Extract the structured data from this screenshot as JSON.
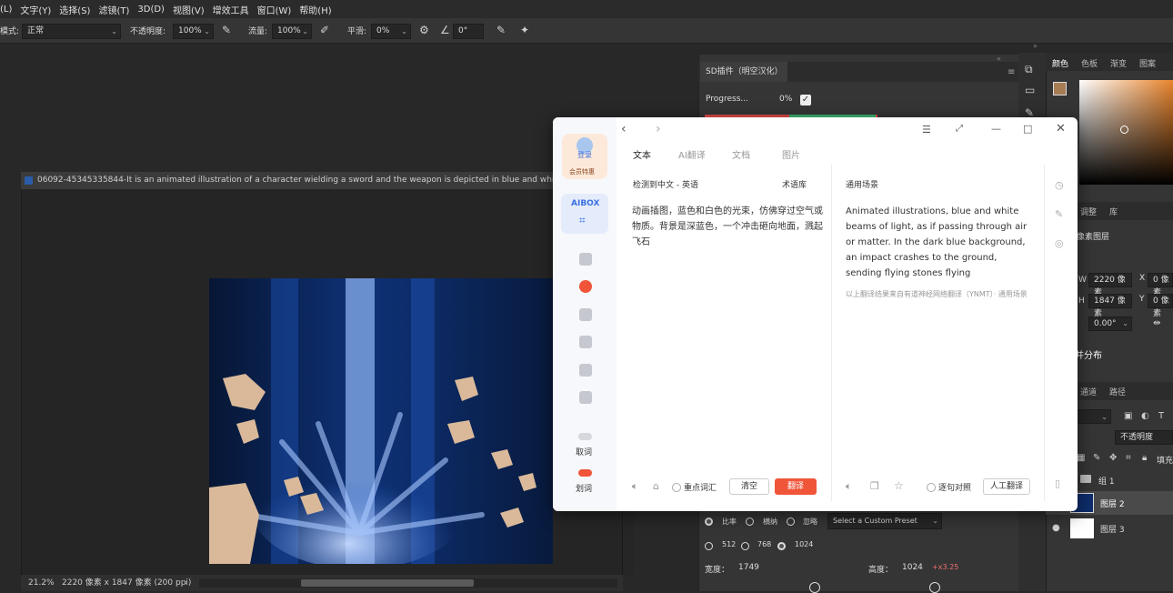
{
  "menubar": {
    "items": [
      "(L)",
      "文字(Y)",
      "选择(S)",
      "滤镜(T)",
      "3D(D)",
      "视图(V)",
      "增效工具",
      "窗口(W)",
      "帮助(H)"
    ]
  },
  "options": {
    "mode_label": "模式:",
    "mode_value": "正常",
    "opacity_label": "不透明度:",
    "opacity_value": "100%",
    "flow_label": "流量:",
    "flow_value": "100%",
    "smooth_label": "平滑:",
    "smooth_value": "0%",
    "angle_value": "0°"
  },
  "document": {
    "tab_title": "06092-45345335844-It is an animated illustration of a character wielding a sword and the weapon is depicted in blue and white lig...",
    "zoom": "21.2%",
    "info": "2220 像素 x 1847 像素 (200 ppi)"
  },
  "sd_plugin": {
    "tab_title": "SD插件（明空汉化）",
    "progress_label": "Progress...",
    "progress_value": "0%",
    "ratio_labels": [
      "比率",
      "横纳",
      "忽略"
    ],
    "preset_value": "Select a Custom Preset",
    "size_options": [
      "512",
      "768",
      "1024"
    ],
    "width_label": "宽度：",
    "width_value": "1749",
    "height_label": "高度：",
    "height_value": "1024",
    "scale_value": "+x3.25"
  },
  "right_panel": {
    "color_tabs": [
      "颜色",
      "色板",
      "渐变",
      "图案"
    ],
    "adjust_tabs": [
      "调整",
      "库"
    ],
    "pixel_layer": "像素图层",
    "w_label": "W",
    "w_value": "2220 像素",
    "h_label": "H",
    "h_value": "1847 像素",
    "x_value": "0 像素",
    "y_value": "0 像素",
    "angle_value": "0.00°",
    "distribute_label": "并分布",
    "layer_tabs": [
      "通道",
      "路径"
    ],
    "opacity_label": "不透明度",
    "fill_label": "填充",
    "layers": [
      "组 1",
      "图层 2",
      "图层 3"
    ]
  },
  "translator": {
    "login_label": "登录",
    "member_label": "会员特惠",
    "box_label": "AIBOX",
    "tabs": [
      "文本",
      "AI翻译",
      "文档",
      "图片"
    ],
    "source_lang": "检测到中文 - 英语",
    "glossary": "术语库",
    "scene": "通用场景",
    "source_text": "动画插图，蓝色和白色的光束，仿佛穿过空气或物质。背景是深蓝色，一个冲击砸向地面，溅起飞石",
    "result_text": "Animated illustrations, blue and white beams of light, as if passing through air or matter. In the dark blue background, an impact crashes to the ground, sending flying stones flying",
    "result_note": "以上翻译结果来自有道神经网络翻译（YNMT）· 通用场景",
    "side_take_word": "取词",
    "side_select_word": "划词",
    "key_vocab": "重点词汇",
    "clear_button": "清空",
    "translate_button": "翻译",
    "compare_label": "逐句对照",
    "human_translate": "人工翻译"
  },
  "colors": {
    "accent_red": "#f0553a",
    "photoshop_bg": "#282828",
    "panel_bg": "#353535",
    "foreground_swatch": "#a67c55"
  }
}
